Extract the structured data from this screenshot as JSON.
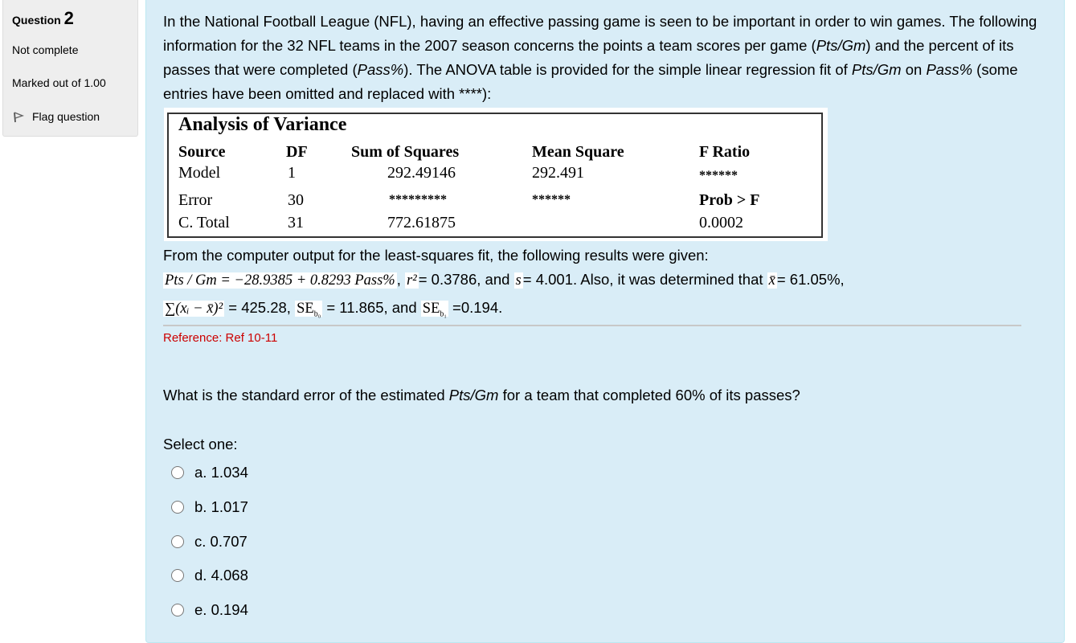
{
  "info": {
    "question_label": "Question",
    "question_number": "2",
    "state": "Not complete",
    "grade": "Marked out of 1.00",
    "flag_label": "Flag question"
  },
  "content": {
    "intro": {
      "part1": "In the National Football League (NFL), having an effective passing game is seen to be important in order to win games. The following information for the 32 NFL teams in the 2007 season concerns the points a team scores per game (",
      "pts_gm": "Pts/Gm",
      "part2": ") and the percent of its passes that were completed (",
      "pass_pct": "Pass%",
      "part3": "). The ANOVA table is provided for the simple linear regression fit of ",
      "pts_gm_2": "Pts/Gm",
      "part4": " on ",
      "pass_pct_2": "Pass%",
      "part5": " (some entries have been omitted and replaced with ****):"
    },
    "anova": {
      "title": "Analysis of Variance",
      "headers": [
        "Source",
        "DF",
        "Sum of Squares",
        "Mean Square",
        "F Ratio"
      ],
      "rows": [
        {
          "source": "Model",
          "df": "1",
          "ss": "292.49146",
          "ms": "292.491",
          "f": "******"
        },
        {
          "source": "Error",
          "df": "30",
          "ss": "*********",
          "ms": "******",
          "f": "Prob > F"
        },
        {
          "source": "C. Total",
          "df": "31",
          "ss": "772.61875",
          "ms": "",
          "f": "0.0002"
        }
      ]
    },
    "results_intro": "From the computer output for the least-squares fit, the following results were given:",
    "results": {
      "equation": "Pts / Gm = −28.9385 + 0.8293 Pass%",
      "comma": ",",
      "r2_symbol": "r²",
      "r2_text": "= 0.3786, and",
      "s_symbol": "s",
      "s_text": "= 4.001. Also, it was determined that",
      "xbar_symbol": "x̄",
      "xbar_text": "= 61.05%,",
      "sum_symbol": "∑(xᵢ − x̄)²",
      "sum_text": "= 425.28,",
      "se_b0_symbol": "SE",
      "se_b0_sub": "b₀",
      "se_b0_text": "= 11.865, and",
      "se_b1_symbol": "SE",
      "se_b1_sub": "b₁",
      "se_b1_text": "=0.194."
    },
    "reference": "Reference: Ref 10-11",
    "question": {
      "part1": "What is the standard error of the estimated ",
      "pts_gm": "Pts/Gm",
      "part2": " for a team that completed 60% of its passes?"
    },
    "select_label": "Select one:",
    "options": [
      {
        "label": "a. 1.034"
      },
      {
        "label": "b. 1.017"
      },
      {
        "label": "c. 0.707"
      },
      {
        "label": "d. 4.068"
      },
      {
        "label": "e. 0.194"
      }
    ]
  }
}
